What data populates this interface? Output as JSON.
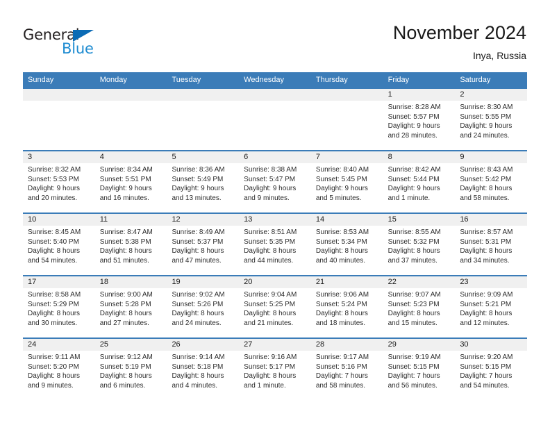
{
  "brand": {
    "name_part1": "General",
    "name_part2": "Blue",
    "triangle_color": "#0b6bb5",
    "blue_color": "#1d8bd1"
  },
  "header": {
    "title": "November 2024",
    "subtitle": "Inya, Russia"
  },
  "theme": {
    "header_blue": "#3b7cb8",
    "band_gray": "#f0f0f0",
    "text": "#1a1a1a"
  },
  "weekdays": [
    "Sunday",
    "Monday",
    "Tuesday",
    "Wednesday",
    "Thursday",
    "Friday",
    "Saturday"
  ],
  "weeks": [
    [
      {
        "day": "",
        "sunrise": "",
        "sunset": "",
        "daylight1": "",
        "daylight2": ""
      },
      {
        "day": "",
        "sunrise": "",
        "sunset": "",
        "daylight1": "",
        "daylight2": ""
      },
      {
        "day": "",
        "sunrise": "",
        "sunset": "",
        "daylight1": "",
        "daylight2": ""
      },
      {
        "day": "",
        "sunrise": "",
        "sunset": "",
        "daylight1": "",
        "daylight2": ""
      },
      {
        "day": "",
        "sunrise": "",
        "sunset": "",
        "daylight1": "",
        "daylight2": ""
      },
      {
        "day": "1",
        "sunrise": "Sunrise: 8:28 AM",
        "sunset": "Sunset: 5:57 PM",
        "daylight1": "Daylight: 9 hours",
        "daylight2": "and 28 minutes."
      },
      {
        "day": "2",
        "sunrise": "Sunrise: 8:30 AM",
        "sunset": "Sunset: 5:55 PM",
        "daylight1": "Daylight: 9 hours",
        "daylight2": "and 24 minutes."
      }
    ],
    [
      {
        "day": "3",
        "sunrise": "Sunrise: 8:32 AM",
        "sunset": "Sunset: 5:53 PM",
        "daylight1": "Daylight: 9 hours",
        "daylight2": "and 20 minutes."
      },
      {
        "day": "4",
        "sunrise": "Sunrise: 8:34 AM",
        "sunset": "Sunset: 5:51 PM",
        "daylight1": "Daylight: 9 hours",
        "daylight2": "and 16 minutes."
      },
      {
        "day": "5",
        "sunrise": "Sunrise: 8:36 AM",
        "sunset": "Sunset: 5:49 PM",
        "daylight1": "Daylight: 9 hours",
        "daylight2": "and 13 minutes."
      },
      {
        "day": "6",
        "sunrise": "Sunrise: 8:38 AM",
        "sunset": "Sunset: 5:47 PM",
        "daylight1": "Daylight: 9 hours",
        "daylight2": "and 9 minutes."
      },
      {
        "day": "7",
        "sunrise": "Sunrise: 8:40 AM",
        "sunset": "Sunset: 5:45 PM",
        "daylight1": "Daylight: 9 hours",
        "daylight2": "and 5 minutes."
      },
      {
        "day": "8",
        "sunrise": "Sunrise: 8:42 AM",
        "sunset": "Sunset: 5:44 PM",
        "daylight1": "Daylight: 9 hours",
        "daylight2": "and 1 minute."
      },
      {
        "day": "9",
        "sunrise": "Sunrise: 8:43 AM",
        "sunset": "Sunset: 5:42 PM",
        "daylight1": "Daylight: 8 hours",
        "daylight2": "and 58 minutes."
      }
    ],
    [
      {
        "day": "10",
        "sunrise": "Sunrise: 8:45 AM",
        "sunset": "Sunset: 5:40 PM",
        "daylight1": "Daylight: 8 hours",
        "daylight2": "and 54 minutes."
      },
      {
        "day": "11",
        "sunrise": "Sunrise: 8:47 AM",
        "sunset": "Sunset: 5:38 PM",
        "daylight1": "Daylight: 8 hours",
        "daylight2": "and 51 minutes."
      },
      {
        "day": "12",
        "sunrise": "Sunrise: 8:49 AM",
        "sunset": "Sunset: 5:37 PM",
        "daylight1": "Daylight: 8 hours",
        "daylight2": "and 47 minutes."
      },
      {
        "day": "13",
        "sunrise": "Sunrise: 8:51 AM",
        "sunset": "Sunset: 5:35 PM",
        "daylight1": "Daylight: 8 hours",
        "daylight2": "and 44 minutes."
      },
      {
        "day": "14",
        "sunrise": "Sunrise: 8:53 AM",
        "sunset": "Sunset: 5:34 PM",
        "daylight1": "Daylight: 8 hours",
        "daylight2": "and 40 minutes."
      },
      {
        "day": "15",
        "sunrise": "Sunrise: 8:55 AM",
        "sunset": "Sunset: 5:32 PM",
        "daylight1": "Daylight: 8 hours",
        "daylight2": "and 37 minutes."
      },
      {
        "day": "16",
        "sunrise": "Sunrise: 8:57 AM",
        "sunset": "Sunset: 5:31 PM",
        "daylight1": "Daylight: 8 hours",
        "daylight2": "and 34 minutes."
      }
    ],
    [
      {
        "day": "17",
        "sunrise": "Sunrise: 8:58 AM",
        "sunset": "Sunset: 5:29 PM",
        "daylight1": "Daylight: 8 hours",
        "daylight2": "and 30 minutes."
      },
      {
        "day": "18",
        "sunrise": "Sunrise: 9:00 AM",
        "sunset": "Sunset: 5:28 PM",
        "daylight1": "Daylight: 8 hours",
        "daylight2": "and 27 minutes."
      },
      {
        "day": "19",
        "sunrise": "Sunrise: 9:02 AM",
        "sunset": "Sunset: 5:26 PM",
        "daylight1": "Daylight: 8 hours",
        "daylight2": "and 24 minutes."
      },
      {
        "day": "20",
        "sunrise": "Sunrise: 9:04 AM",
        "sunset": "Sunset: 5:25 PM",
        "daylight1": "Daylight: 8 hours",
        "daylight2": "and 21 minutes."
      },
      {
        "day": "21",
        "sunrise": "Sunrise: 9:06 AM",
        "sunset": "Sunset: 5:24 PM",
        "daylight1": "Daylight: 8 hours",
        "daylight2": "and 18 minutes."
      },
      {
        "day": "22",
        "sunrise": "Sunrise: 9:07 AM",
        "sunset": "Sunset: 5:23 PM",
        "daylight1": "Daylight: 8 hours",
        "daylight2": "and 15 minutes."
      },
      {
        "day": "23",
        "sunrise": "Sunrise: 9:09 AM",
        "sunset": "Sunset: 5:21 PM",
        "daylight1": "Daylight: 8 hours",
        "daylight2": "and 12 minutes."
      }
    ],
    [
      {
        "day": "24",
        "sunrise": "Sunrise: 9:11 AM",
        "sunset": "Sunset: 5:20 PM",
        "daylight1": "Daylight: 8 hours",
        "daylight2": "and 9 minutes."
      },
      {
        "day": "25",
        "sunrise": "Sunrise: 9:12 AM",
        "sunset": "Sunset: 5:19 PM",
        "daylight1": "Daylight: 8 hours",
        "daylight2": "and 6 minutes."
      },
      {
        "day": "26",
        "sunrise": "Sunrise: 9:14 AM",
        "sunset": "Sunset: 5:18 PM",
        "daylight1": "Daylight: 8 hours",
        "daylight2": "and 4 minutes."
      },
      {
        "day": "27",
        "sunrise": "Sunrise: 9:16 AM",
        "sunset": "Sunset: 5:17 PM",
        "daylight1": "Daylight: 8 hours",
        "daylight2": "and 1 minute."
      },
      {
        "day": "28",
        "sunrise": "Sunrise: 9:17 AM",
        "sunset": "Sunset: 5:16 PM",
        "daylight1": "Daylight: 7 hours",
        "daylight2": "and 58 minutes."
      },
      {
        "day": "29",
        "sunrise": "Sunrise: 9:19 AM",
        "sunset": "Sunset: 5:15 PM",
        "daylight1": "Daylight: 7 hours",
        "daylight2": "and 56 minutes."
      },
      {
        "day": "30",
        "sunrise": "Sunrise: 9:20 AM",
        "sunset": "Sunset: 5:15 PM",
        "daylight1": "Daylight: 7 hours",
        "daylight2": "and 54 minutes."
      }
    ]
  ]
}
